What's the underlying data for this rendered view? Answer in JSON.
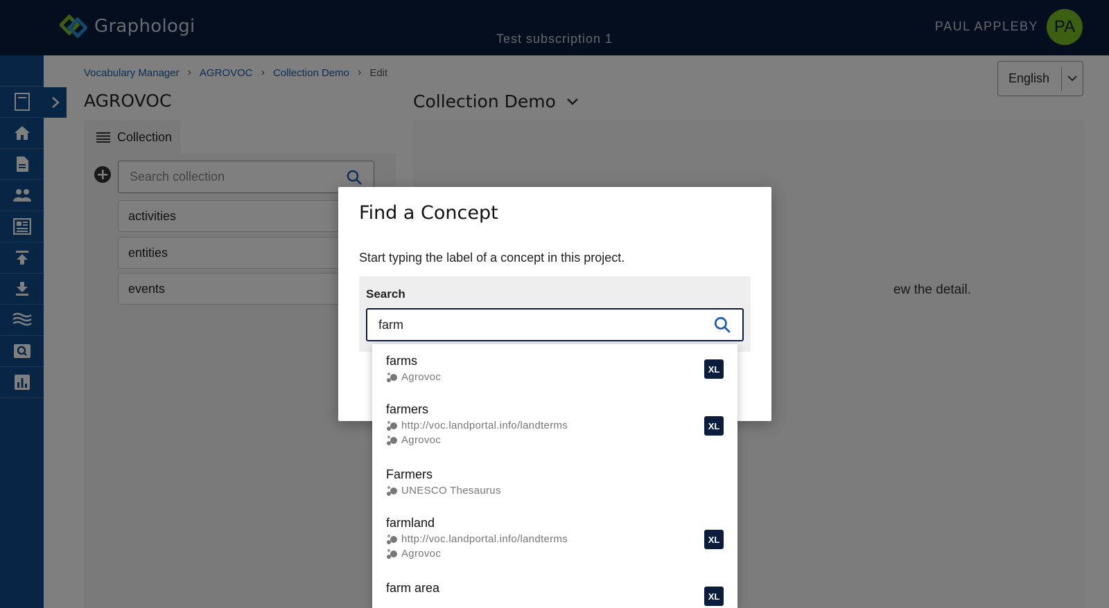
{
  "app": {
    "logo_text": "Graphologi",
    "subscription": "Test subscription 1",
    "user_name": "PAUL APPLEBY",
    "user_initials": "PA"
  },
  "sidebar": {
    "items": [
      {
        "icon": "home-icon"
      },
      {
        "icon": "document-icon"
      },
      {
        "icon": "people-icon"
      },
      {
        "icon": "dashboard-icon"
      },
      {
        "icon": "upload-icon"
      },
      {
        "icon": "download-icon"
      },
      {
        "icon": "waves-icon"
      },
      {
        "icon": "search-screen-icon"
      },
      {
        "icon": "chart-icon"
      }
    ]
  },
  "breadcrumb": {
    "items": [
      "Vocabulary Manager",
      "AGROVOC",
      "Collection Demo"
    ],
    "current": "Edit"
  },
  "language": {
    "selected": "English"
  },
  "project_title": "AGROVOC",
  "collection_title": "Collection Demo",
  "left_panel": {
    "tab_label": "Collection",
    "search_placeholder": "Search collection",
    "items": [
      "activities",
      "entities",
      "events"
    ]
  },
  "right_panel": {
    "hint_visible": "ew the detail."
  },
  "modal": {
    "title": "Find a Concept",
    "description": "Start typing the label of a concept in this project.",
    "search_label": "Search",
    "search_value": "farm"
  },
  "results": [
    {
      "label": "farms",
      "sources": [
        "Agrovoc"
      ],
      "badge": "XL"
    },
    {
      "label": "farmers",
      "sources": [
        "http://voc.landportal.info/landterms",
        "Agrovoc"
      ],
      "badge": "XL"
    },
    {
      "label": "Farmers",
      "sources": [
        "UNESCO Thesaurus"
      ],
      "badge": ""
    },
    {
      "label": "farmland",
      "sources": [
        "http://voc.landportal.info/landterms",
        "Agrovoc"
      ],
      "badge": "XL"
    },
    {
      "label": "farm area",
      "sources": [],
      "badge": "XL"
    }
  ],
  "colors": {
    "topbar": "#0a1d3d",
    "sidebar": "#0e4a8a",
    "avatar": "#7bbf22",
    "link": "#1a5cae",
    "badge": "#0a1d3d"
  }
}
